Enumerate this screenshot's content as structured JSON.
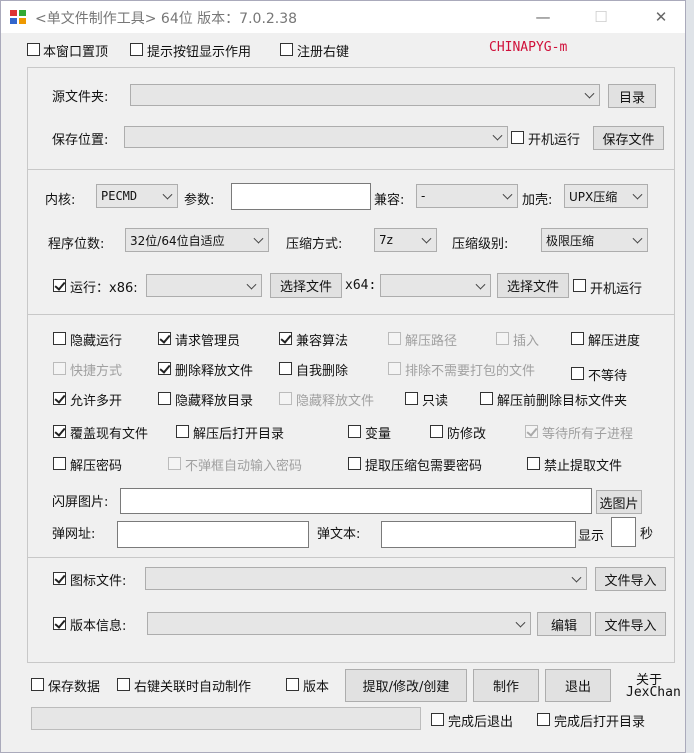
{
  "window": {
    "title": "<单文件制作工具> 64位 版本：7.0.2.38",
    "minimize": "—",
    "maximize": "☐",
    "close": "✕"
  },
  "topbar": {
    "stay_on_top": "本窗口置顶",
    "show_tips": "提示按钮显示作用",
    "register_context": "注册右键",
    "brand": "CHINAPYG-m"
  },
  "source": {
    "label": "源文件夹:",
    "dir_button": "目录"
  },
  "save": {
    "label": "保存位置:",
    "boot_run": "开机运行",
    "save_file_button": "保存文件"
  },
  "core": {
    "kernel_label": "内核:",
    "kernel_value": "PECMD",
    "params_label": "参数:",
    "compat_label": "兼容:",
    "compat_value": "-",
    "shell_label": "加壳:",
    "shell_value": "UPX压缩"
  },
  "bits": {
    "label": "程序位数:",
    "value": "32位/64位自适应",
    "compress_label": "压缩方式:",
    "compress_value": "7z",
    "level_label": "压缩级别:",
    "level_value": "极限压缩"
  },
  "run": {
    "label": "运行：x86:",
    "choose_file_1": "选择文件",
    "x64_label": "x64:",
    "choose_file_2": "选择文件",
    "boot_run": "开机运行"
  },
  "options": {
    "hide_run": "隐藏运行",
    "request_admin": "请求管理员",
    "compat_algo": "兼容算法",
    "extract_path": "解压路径",
    "insert": "插入",
    "extract_progress": "解压进度",
    "shortcut": "快捷方式",
    "delete_release": "删除释放文件",
    "self_delete": "自我删除",
    "exclude_pack": "排除不需要打包的文件",
    "no_wait": "不等待",
    "allow_multi": "允许多开",
    "hide_release_dir": "隐藏释放目录",
    "hide_release_file": "隐藏释放文件",
    "readonly": "只读",
    "delete_target_before": "解压前删除目标文件夹",
    "overwrite": "覆盖现有文件",
    "open_dir_after": "解压后打开目录",
    "variable": "变量",
    "anti_modify": "防修改",
    "wait_children": "等待所有子进程",
    "extract_password": "解压密码",
    "no_popup_password": "不弹框自动输入密码",
    "need_password": "提取压缩包需要密码",
    "forbid_extract": "禁止提取文件"
  },
  "splash": {
    "label": "闪屏图片:",
    "button": "选图片"
  },
  "popup": {
    "url_label": "弹网址:",
    "text_label": "弹文本:",
    "show_label": "显示",
    "sec_label": "秒"
  },
  "icon": {
    "label": "图标文件:",
    "import_button": "文件导入"
  },
  "version": {
    "label": "版本信息:",
    "edit_button": "编辑",
    "import_button": "文件导入"
  },
  "bottom": {
    "save_data": "保存数据",
    "auto_make": "右键关联时自动制作",
    "version": "版本",
    "extract_button": "提取/修改/创建",
    "make_button": "制作",
    "exit_button": "退出",
    "about": "关于",
    "author": "JexChan",
    "exit_after": "完成后退出",
    "open_after": "完成后打开目录"
  }
}
